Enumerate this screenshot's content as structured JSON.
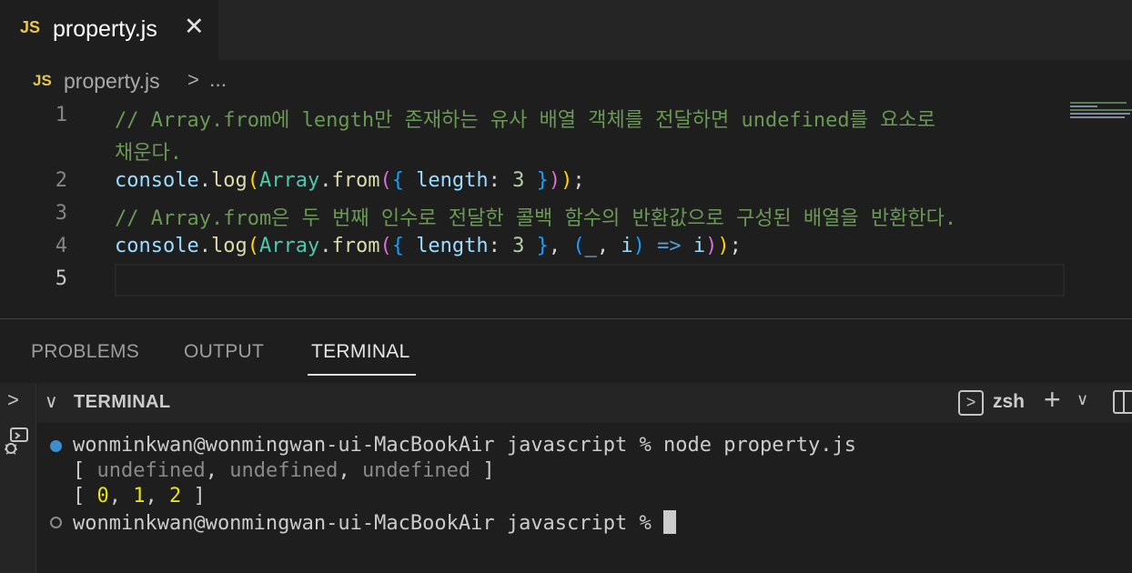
{
  "tab": {
    "icon": "JS",
    "filename": "property.js",
    "close": "✕"
  },
  "breadcrumb": {
    "icon": "JS",
    "filename": "property.js",
    "separator": ">",
    "more": "..."
  },
  "editor": {
    "line_numbers": [
      "1",
      "2",
      "3",
      "4",
      "5"
    ],
    "line1": "// Array.from에 length만 존재하는 유사 배열 객체를 전달하면 undefined를 요소로",
    "line1_wrap": "채운다.",
    "line3": "// Array.from은 두 번째 인수로 전달한 콜백 함수의 반환값으로 구성된 배열을 반환한다.",
    "tokens": {
      "console": "console",
      "dot": ".",
      "log": "log",
      "lparen": "(",
      "rparen": ")",
      "Array": "Array",
      "from": "from",
      "lbrace": "{",
      "rbrace": "}",
      "length": "length",
      "colon": ":",
      "three": "3",
      "semicolon": ";",
      "comma": ",",
      "underscore": "_",
      "i": "i",
      "arrow": "=>"
    }
  },
  "panel": {
    "tabs": [
      "PROBLEMS",
      "OUTPUT",
      "TERMINAL"
    ],
    "active_tab": "TERMINAL",
    "terminal_title": "TERMINAL",
    "shell": "zsh"
  },
  "terminal": {
    "prompt": "wonminkwan@wonmingwan-ui-MacBookAir javascript %",
    "command": "node property.js",
    "output1": {
      "open": "[",
      "items": [
        "undefined",
        "undefined",
        "undefined"
      ],
      "close": "]"
    },
    "output2": {
      "open": "[",
      "items": [
        "0",
        "1",
        "2"
      ],
      "close": "]"
    }
  },
  "colors": {
    "accent": "#3a8fd1",
    "comment": "#6a9955",
    "class": "#4ec9b0",
    "function": "#dcdcaa",
    "variable": "#9cdcfe"
  }
}
